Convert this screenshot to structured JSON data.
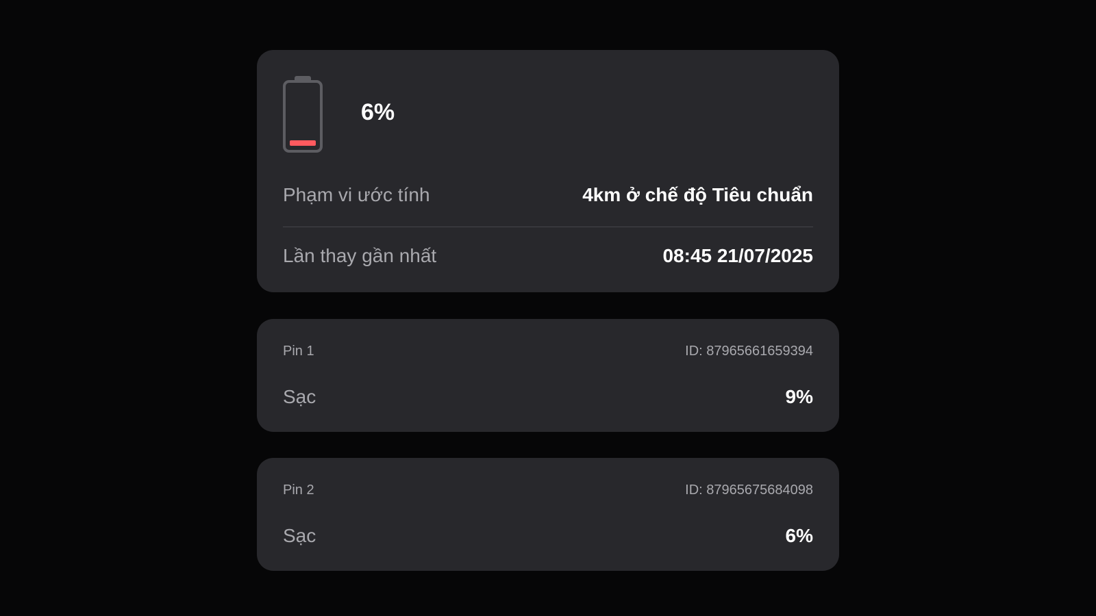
{
  "summary": {
    "battery_icon": "battery-low-icon",
    "battery_level": 0.06,
    "level_text": "6%",
    "fill_color": "#ff5a5f",
    "range_label": "Phạm vi ước tính",
    "range_value": "4km ở chế độ Tiêu chuẩn",
    "last_swap_label": "Lần thay gần nhất",
    "last_swap_value": "08:45 21/07/2025"
  },
  "pins": [
    {
      "name": "Pin 1",
      "id_text": "ID: 87965661659394",
      "status_label": "Sạc",
      "value": "9%"
    },
    {
      "name": "Pin 2",
      "id_text": "ID: 87965675684098",
      "status_label": "Sạc",
      "value": "6%"
    }
  ]
}
